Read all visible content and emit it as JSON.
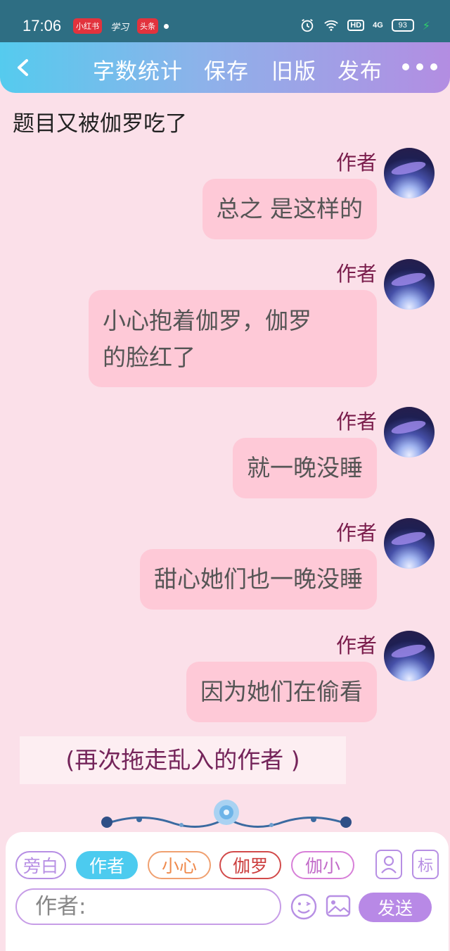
{
  "status_bar": {
    "time": "17:06",
    "apps": [
      "小红书",
      "学习",
      "头条"
    ],
    "hd": "HD",
    "signal": "4G",
    "battery": "93"
  },
  "nav": {
    "back_icon": "chevron-left-icon",
    "items": [
      "字数统计",
      "保存",
      "旧版",
      "发布"
    ],
    "more_icon": "more-dots-icon"
  },
  "story_title": "题目又被伽罗吃了",
  "messages": [
    {
      "speaker": "作者",
      "text": "总之 是这样的"
    },
    {
      "speaker": "作者",
      "text": "小心抱着伽罗，伽罗",
      "text2": "的脸红了"
    },
    {
      "speaker": "作者",
      "text": "就一晚没睡"
    },
    {
      "speaker": "作者",
      "text": "甜心她们也一晚没睡"
    },
    {
      "speaker": "作者",
      "text": "因为她们在偷看"
    }
  ],
  "narration": "(再次拖走乱入的作者 )",
  "composer": {
    "roles": [
      "旁白",
      "作者",
      "小心",
      "伽罗",
      "伽小"
    ],
    "active_role": "作者",
    "user_icon_label": "",
    "biao_label": "标",
    "input_placeholder": "作者:",
    "emoji_icon": "smiley-icon",
    "image_icon": "image-icon",
    "send_label": "发送"
  },
  "colors": {
    "background": "#fbe0e9",
    "bubble": "#fec9d7",
    "accent_blue": "#4ccbef",
    "accent_purple": "#b889e6",
    "speaker_name": "#7a1d4c"
  }
}
